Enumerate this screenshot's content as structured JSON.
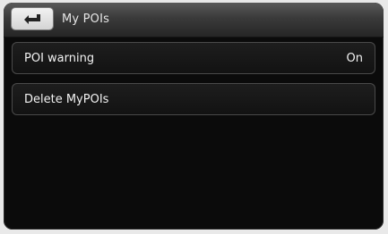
{
  "header": {
    "title": "My POIs",
    "back_icon": "back-arrow-icon"
  },
  "rows": [
    {
      "label": "POI warning",
      "value": "On"
    },
    {
      "label": "Delete MyPOIs"
    }
  ]
}
